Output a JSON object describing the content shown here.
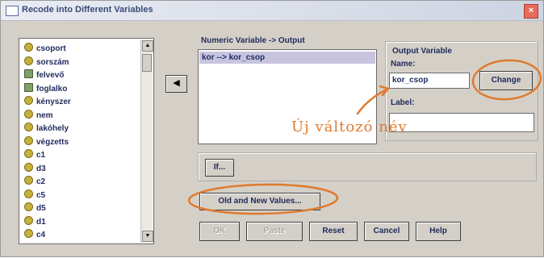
{
  "window": {
    "title": "Recode into Different Variables",
    "close_glyph": "×"
  },
  "variables": [
    {
      "label": "csoport",
      "icon": "scale-variable-icon"
    },
    {
      "label": "sorszám",
      "icon": "scale-variable-icon"
    },
    {
      "label": "felvevő",
      "icon": "nominal-variable-icon"
    },
    {
      "label": "foglalko",
      "icon": "nominal-variable-icon"
    },
    {
      "label": "kényszer",
      "icon": "scale-variable-icon"
    },
    {
      "label": "nem",
      "icon": "scale-variable-icon"
    },
    {
      "label": "lakóhely",
      "icon": "scale-variable-icon"
    },
    {
      "label": "végzetts",
      "icon": "scale-variable-icon"
    },
    {
      "label": "c1",
      "icon": "scale-variable-icon"
    },
    {
      "label": "d3",
      "icon": "scale-variable-icon"
    },
    {
      "label": "c2",
      "icon": "scale-variable-icon"
    },
    {
      "label": "c5",
      "icon": "scale-variable-icon"
    },
    {
      "label": "d5",
      "icon": "scale-variable-icon"
    },
    {
      "label": "d1",
      "icon": "scale-variable-icon"
    },
    {
      "label": "c4",
      "icon": "scale-variable-icon"
    }
  ],
  "move_button": {
    "glyph": "◀"
  },
  "mapping": {
    "header": "Numeric Variable -> Output",
    "rows": [
      "kor --> kor_csop"
    ]
  },
  "output": {
    "group_title": "Output Variable",
    "name_label": "Name:",
    "name_value": "kor_csop",
    "change_label": "Change",
    "label_label": "Label:",
    "label_value": ""
  },
  "if_button": "If...",
  "old_new_button": "Old and New Values...",
  "buttons": {
    "ok": "OK",
    "paste": "Paste",
    "reset": "Reset",
    "cancel": "Cancel",
    "help": "Help"
  },
  "annotation": {
    "text": "Új változó név",
    "color": "#e07a2e"
  }
}
